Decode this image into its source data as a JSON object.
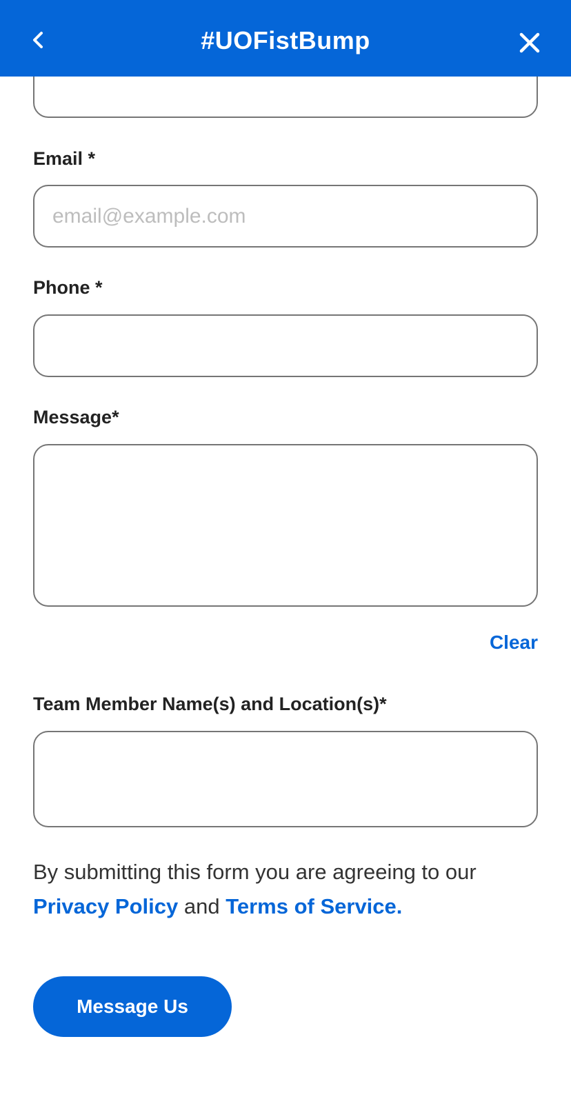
{
  "header": {
    "title": "#UOFistBump",
    "back_icon": "chevron-left-icon",
    "close_icon": "close-icon",
    "background": "#0566d8"
  },
  "form": {
    "name_field": {
      "value": ""
    },
    "email": {
      "label": "Email *",
      "placeholder": "email@example.com",
      "value": ""
    },
    "phone": {
      "label": "Phone *",
      "value": ""
    },
    "message": {
      "label": "Message*",
      "value": ""
    },
    "clear_label": "Clear",
    "team_member": {
      "label": "Team Member Name(s) and Location(s)*",
      "value": ""
    }
  },
  "legal": {
    "prefix": "By submitting this form you are agreeing to our",
    "privacy_link": "Privacy Policy",
    "conjunction": "and",
    "terms_link": "Terms of Service."
  },
  "submit_label": "Message Us"
}
